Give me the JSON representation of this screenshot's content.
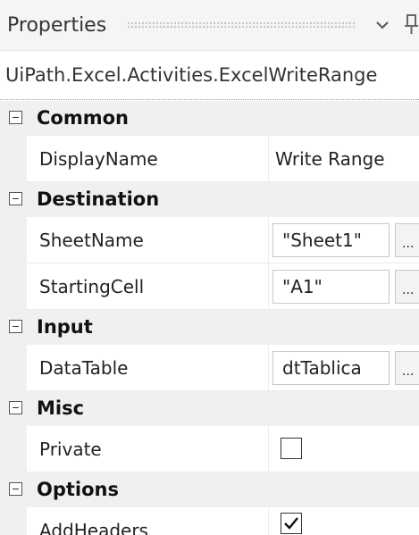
{
  "panel": {
    "title": "Properties",
    "chevron_icon": "chevron-down-icon",
    "pin_icon": "pin-icon",
    "activity_type": "UiPath.Excel.Activities.ExcelWriteRange"
  },
  "categories": [
    {
      "label": "Common",
      "expanded": true,
      "properties": [
        {
          "name": "DisplayName",
          "value": "Write Range",
          "kind": "text"
        }
      ]
    },
    {
      "label": "Destination",
      "expanded": true,
      "properties": [
        {
          "name": "SheetName",
          "value": "\"Sheet1\"",
          "kind": "textbox",
          "button": "..."
        },
        {
          "name": "StartingCell",
          "value": "\"A1\"",
          "kind": "textbox",
          "button": "..."
        }
      ]
    },
    {
      "label": "Input",
      "expanded": true,
      "properties": [
        {
          "name": "DataTable",
          "value": "dtTablica",
          "kind": "textbox",
          "button": "..."
        }
      ]
    },
    {
      "label": "Misc",
      "expanded": true,
      "properties": [
        {
          "name": "Private",
          "checked": false,
          "kind": "checkbox"
        }
      ]
    },
    {
      "label": "Options",
      "expanded": true,
      "properties": [
        {
          "name": "AddHeaders",
          "checked": true,
          "kind": "checkbox"
        }
      ]
    }
  ]
}
